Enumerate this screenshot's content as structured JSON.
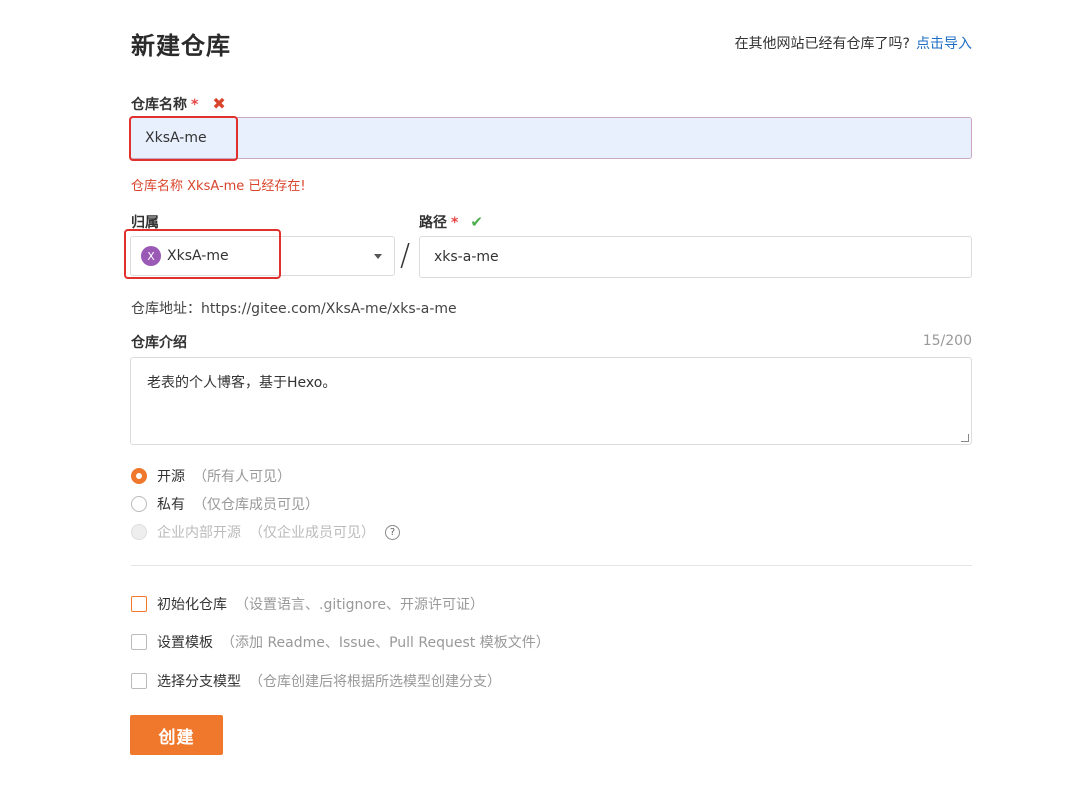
{
  "header": {
    "title": "新建仓库",
    "import_prompt": "在其他网站已经有仓库了吗?",
    "import_link": "点击导入"
  },
  "repo_name": {
    "label": "仓库名称",
    "required_mark": "*",
    "status_icon": "✖",
    "value": "XksA-me",
    "error": "仓库名称 XksA-me 已经存在!"
  },
  "owner": {
    "label": "归属",
    "avatar_letter": "X",
    "value": "XksA-me"
  },
  "separator": "/",
  "path": {
    "label": "路径",
    "required_mark": "*",
    "status_icon": "✔",
    "value": "xks-a-me"
  },
  "repo_address": "仓库地址：https://gitee.com/XksA-me/xks-a-me",
  "description": {
    "label": "仓库介绍",
    "counter": "15/200",
    "value": "老表的个人博客，基于Hexo。"
  },
  "visibility": [
    {
      "label": "开源",
      "hint": "（所有人可见）",
      "selected": true,
      "disabled": false
    },
    {
      "label": "私有",
      "hint": "（仅仓库成员可见）",
      "selected": false,
      "disabled": false
    },
    {
      "label": "企业内部开源",
      "hint": "（仅企业成员可见）",
      "selected": false,
      "disabled": true
    }
  ],
  "help_icon": "?",
  "options": [
    {
      "label": "初始化仓库",
      "hint": "（设置语言、.gitignore、开源许可证）"
    },
    {
      "label": "设置模板",
      "hint": "（添加 Readme、Issue、Pull Request 模板文件）"
    },
    {
      "label": "选择分支模型",
      "hint": "（仓库创建后将根据所选模型创建分支）"
    }
  ],
  "submit_label": "创建",
  "colors": {
    "accent": "#f0782d",
    "error": "#d9452c",
    "link": "#1e6ec4",
    "success": "#4caf50"
  }
}
